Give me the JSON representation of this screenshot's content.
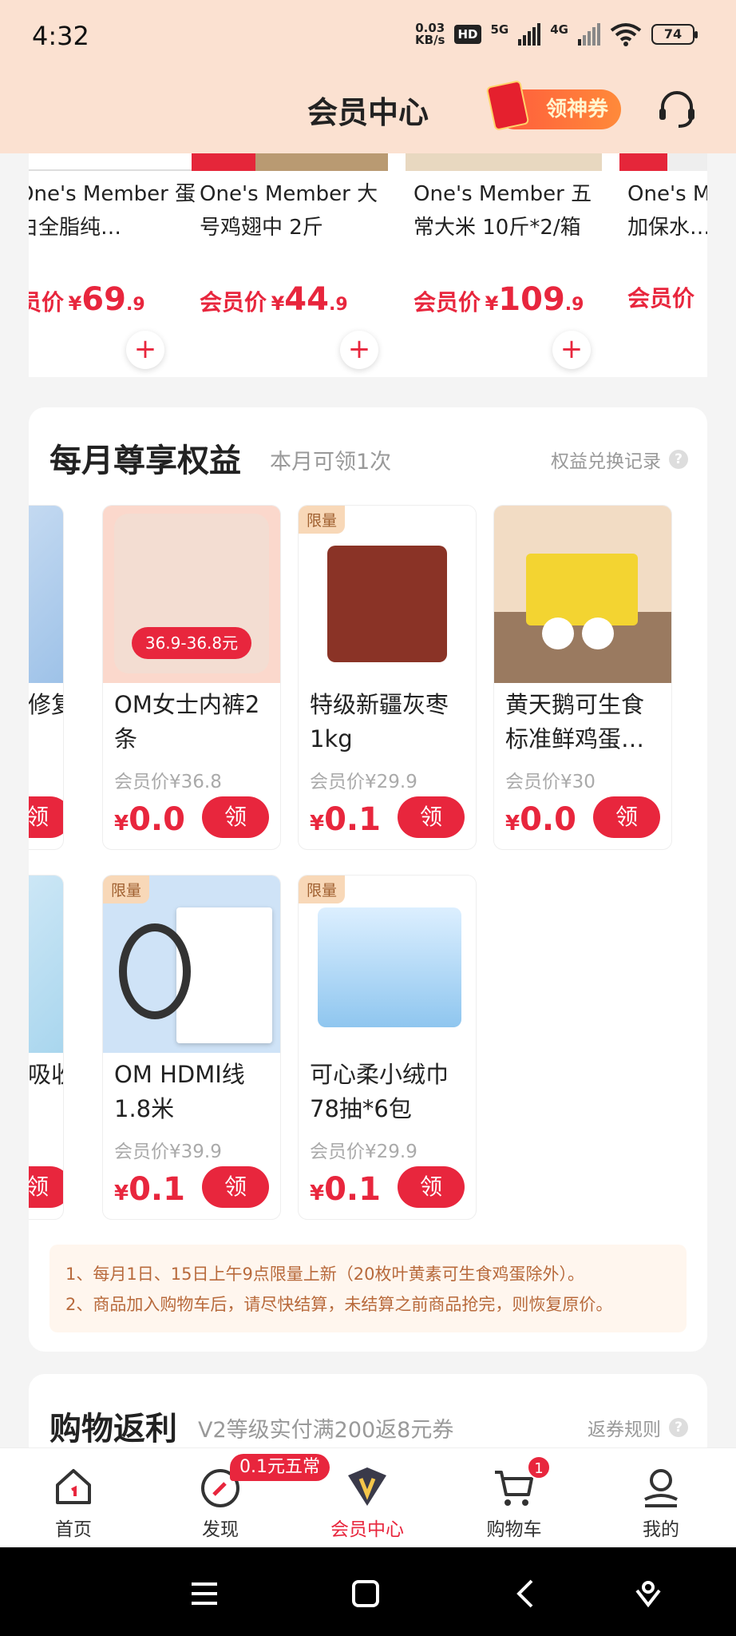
{
  "status_bar": {
    "time": "4:32",
    "net_speed_value": "0.03",
    "net_speed_unit": "KB/s",
    "hd_label": "HD",
    "net1": "5G",
    "net2": "4G",
    "battery": "74"
  },
  "header": {
    "title": "会员中心",
    "coupon_label": "领神券",
    "support_icon": "headset-icon"
  },
  "products": [
    {
      "name": "One's Member 蛋白全脂纯…",
      "price_label": "会员价",
      "currency": "¥",
      "price_int": "69",
      "price_dec": ".9"
    },
    {
      "name": "One's Member 大号鸡翅中 2斤",
      "price_label": "会员价",
      "currency": "¥",
      "price_int": "44",
      "price_dec": ".9"
    },
    {
      "name": "One's Member 五常大米 10斤*2/箱",
      "price_label": "会员价",
      "currency": "¥",
      "price_int": "109",
      "price_dec": ".9"
    },
    {
      "name": "One's Member 添加保水…",
      "price_label": "会员价",
      "currency": "",
      "price_int": "",
      "price_dec": ""
    }
  ],
  "benefits": {
    "title": "每月尊享权益",
    "subtitle": "本月可领1次",
    "record_link": "权益兑换记录",
    "help": "?",
    "items": [
      {
        "tag": "",
        "name": "修复",
        "member_price": "",
        "my_price": "",
        "button": "领"
      },
      {
        "tag": "",
        "name": "OM女士内裤2条",
        "member_price": "会员价¥36.8",
        "currency": "¥",
        "my_price": "0.0",
        "button": "领",
        "promo": "36.9-36.8元"
      },
      {
        "tag": "限量",
        "name": "特级新疆灰枣1kg",
        "member_price": "会员价¥29.9",
        "currency": "¥",
        "my_price": "0.1",
        "button": "领"
      },
      {
        "tag": "",
        "name": "黄天鹅可生食标准鲜鸡蛋…",
        "member_price": "会员价¥30",
        "currency": "¥",
        "my_price": "0.0",
        "button": "领"
      },
      {
        "tag": "",
        "name": "吸收",
        "member_price": "",
        "my_price": "",
        "button": "领"
      },
      {
        "tag": "限量",
        "name": "OM HDMI线1.8米",
        "member_price": "会员价¥39.9",
        "currency": "¥",
        "my_price": "0.1",
        "button": "领"
      },
      {
        "tag": "限量",
        "name": "可心柔小绒巾78抽*6包",
        "member_price": "会员价¥29.9",
        "currency": "¥",
        "my_price": "0.1",
        "button": "领"
      }
    ],
    "notes": [
      "1、每月1日、15日上午9点限量上新（20枚叶黄素可生食鸡蛋除外）。",
      "2、商品加入购物车后，请尽快结算，未结算之前商品抢完，则恢复原价。"
    ]
  },
  "cashback": {
    "title": "购物返利",
    "subtitle": "V2等级实付满200返8元券",
    "rule_link": "返券规则",
    "help": "?"
  },
  "tabbar": {
    "tabs": [
      {
        "label": "首页",
        "icon": "home-icon"
      },
      {
        "label": "发现",
        "icon": "compass-icon"
      },
      {
        "label": "会员中心",
        "icon": "vip-icon"
      },
      {
        "label": "购物车",
        "icon": "cart-icon"
      },
      {
        "label": "我的",
        "icon": "profile-icon"
      }
    ],
    "discover_badge": "0.1元五常",
    "cart_count": "1",
    "active": "会员中心"
  },
  "colors": {
    "accent": "#e8263d",
    "header_bg": "#fbe1d1",
    "note_text": "#b86a3c"
  }
}
